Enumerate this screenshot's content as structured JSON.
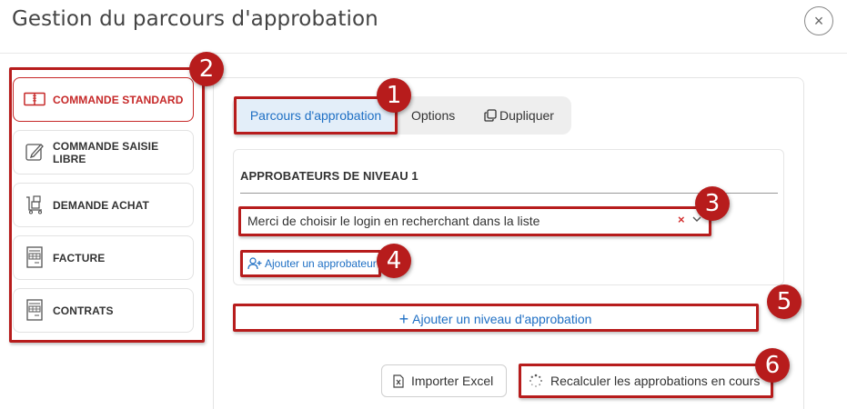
{
  "dialog": {
    "title": "Gestion du parcours d'approbation",
    "close_symbol": "×"
  },
  "sidebar": {
    "items": [
      {
        "label": "COMMANDE STANDARD",
        "icon": "book-icon",
        "active": true
      },
      {
        "label": "COMMANDE SAISIE LIBRE",
        "icon": "edit-document-icon",
        "active": false
      },
      {
        "label": "DEMANDE ACHAT",
        "icon": "cart-boxes-icon",
        "active": false
      },
      {
        "label": "FACTURE",
        "icon": "invoice-icon",
        "active": false
      },
      {
        "label": "CONTRATS",
        "icon": "invoice-icon",
        "active": false
      }
    ]
  },
  "tabs": [
    {
      "label": "Parcours d'approbation",
      "active": true
    },
    {
      "label": "Options",
      "active": false
    },
    {
      "label": "Dupliquer",
      "icon": "copy-icon",
      "active": false
    }
  ],
  "level": {
    "title": "APPROBATEURS DE NIVEAU 1",
    "select_placeholder": "Merci de choisir le login en recherchant dans la liste",
    "clear_symbol": "×",
    "add_approver_label": "Ajouter un approbateur"
  },
  "add_level_label": "Ajouter un niveau d'approbation",
  "add_level_symbol": "+",
  "actions": {
    "import_label": "Importer Excel",
    "recalc_label": "Recalculer les approbations en cours"
  },
  "callouts": [
    "1",
    "2",
    "3",
    "4",
    "5",
    "6"
  ],
  "colors": {
    "accent_red": "#c62828",
    "callout_red": "#b71c1c",
    "link_blue": "#1e6fc4",
    "active_tab_bg": "#e3eef9"
  }
}
